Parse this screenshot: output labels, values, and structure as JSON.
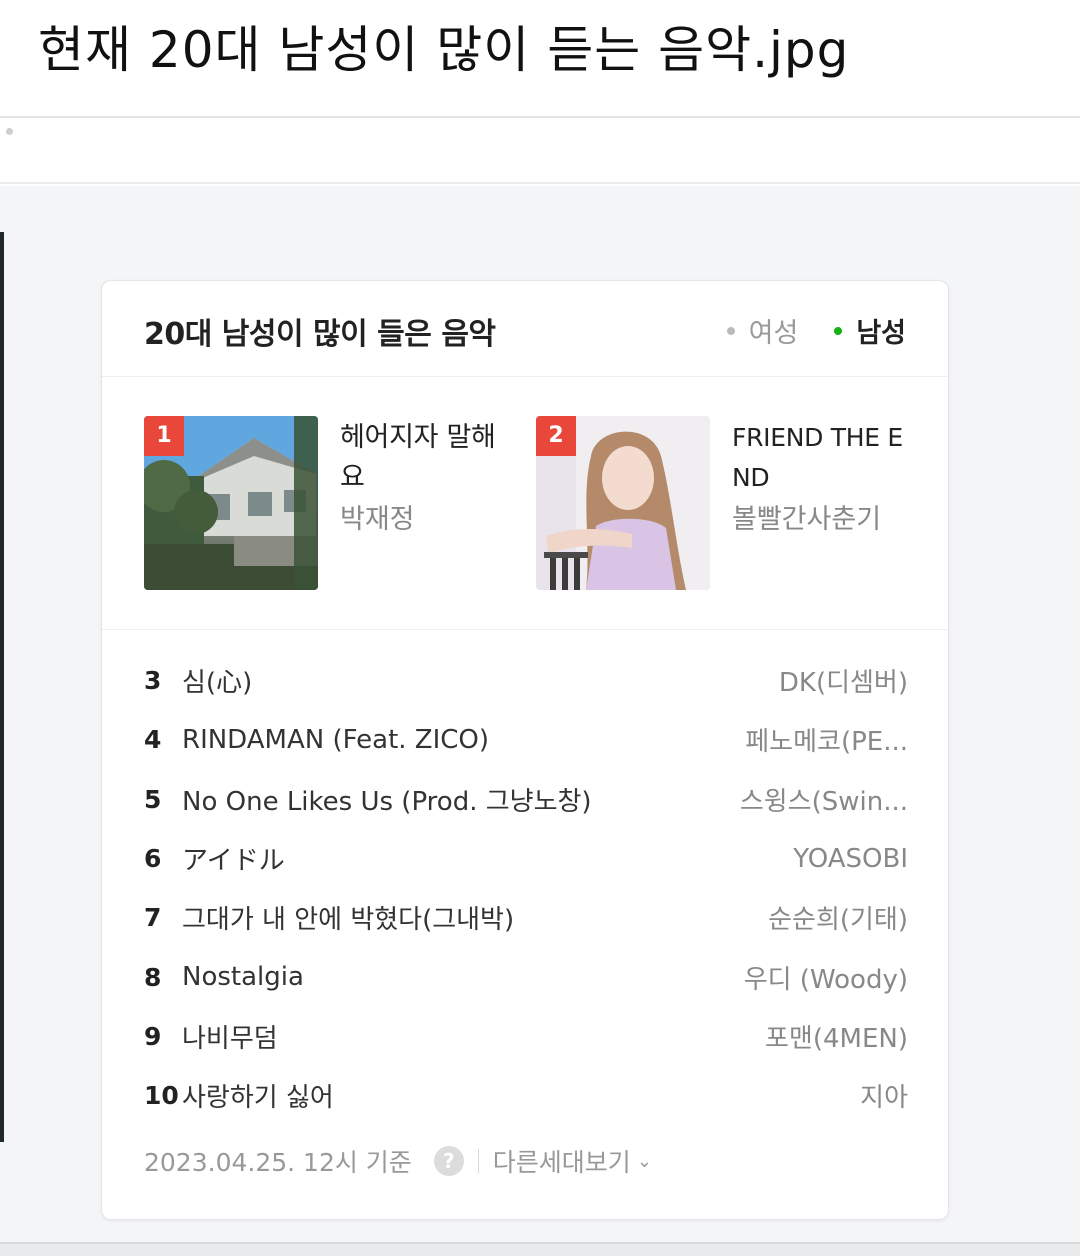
{
  "caption": "현재 20대 남성이 많이 듣는 음악.jpg",
  "chart": {
    "title": "20대 남성이 많이 들은 음악",
    "gender_options": [
      {
        "label": "여성",
        "active": false
      },
      {
        "label": "남성",
        "active": true
      }
    ],
    "accent_color": "#12b312",
    "badge_color": "#e8473a",
    "top": [
      {
        "rank": "1",
        "title": "헤어지자 말해요",
        "artist": "박재정",
        "cover_icon": "album-cover-house"
      },
      {
        "rank": "2",
        "title": "FRIEND THE END",
        "artist": "볼빨간사춘기",
        "cover_icon": "album-cover-portrait"
      }
    ],
    "list": [
      {
        "rank": "3",
        "title": "심(心)",
        "artist": "DK(디셈버)"
      },
      {
        "rank": "4",
        "title": "RINDAMAN (Feat. ZICO)",
        "artist": "페노메코(PE..."
      },
      {
        "rank": "5",
        "title": "No One Likes Us (Prod. 그냥노창)",
        "artist": "스윙스(Swin..."
      },
      {
        "rank": "6",
        "title": "アイドル",
        "artist": "YOASOBI"
      },
      {
        "rank": "7",
        "title": "그대가 내 안에 박혔다(그내박)",
        "artist": "순순희(기태)"
      },
      {
        "rank": "8",
        "title": "Nostalgia",
        "artist": "우디 (Woody)"
      },
      {
        "rank": "9",
        "title": "나비무덤",
        "artist": "포맨(4MEN)"
      },
      {
        "rank": "10",
        "title": "사랑하기 싫어",
        "artist": "지아"
      }
    ],
    "footer": {
      "timestamp": "2023.04.25. 12시 기준",
      "help_icon": "?",
      "more_label": "다른세대보기",
      "more_icon": "chevron-down-icon"
    }
  }
}
